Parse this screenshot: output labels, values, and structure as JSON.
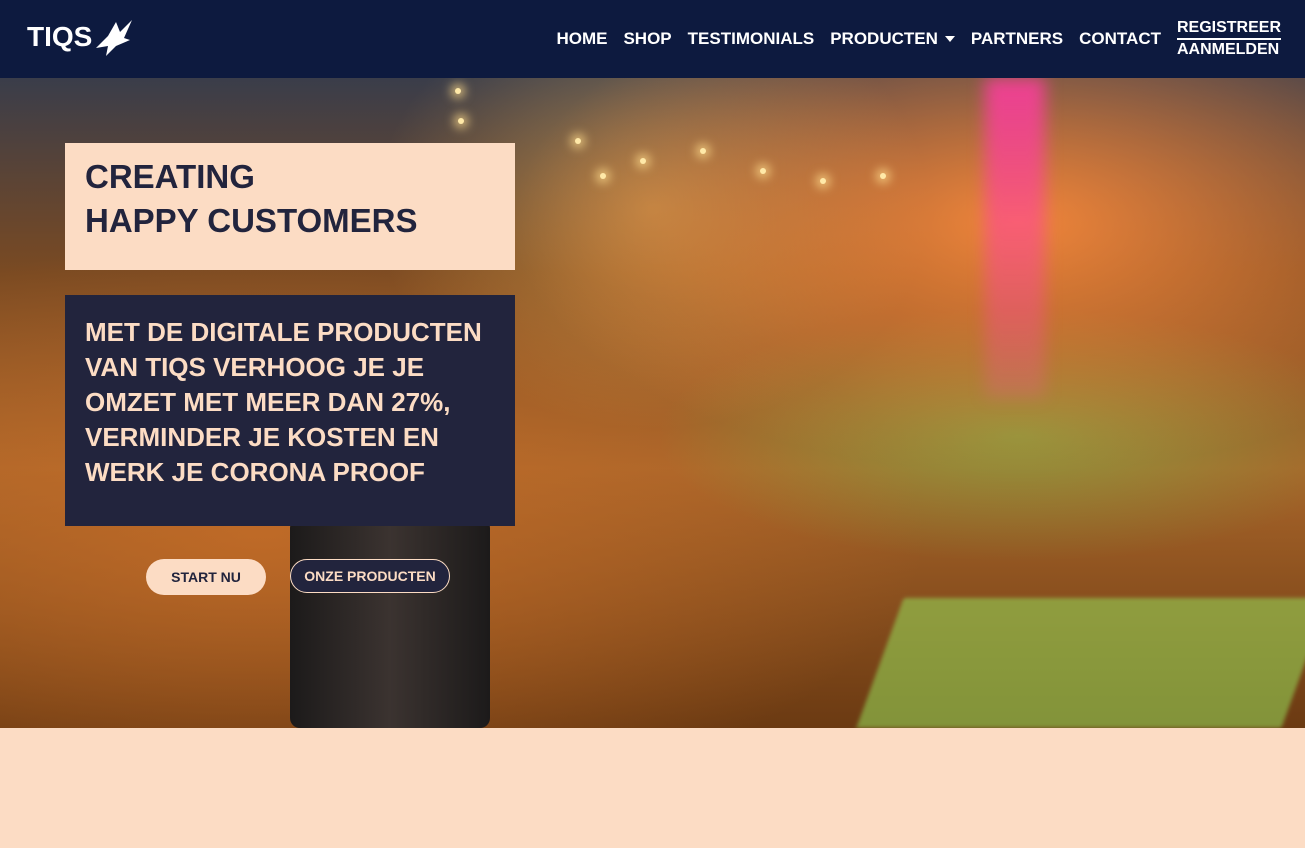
{
  "brand": {
    "name": "TIQS"
  },
  "nav": {
    "items": [
      {
        "label": "HOME"
      },
      {
        "label": "SHOP"
      },
      {
        "label": "TESTIMONIALS"
      },
      {
        "label": "PRODUCTEN"
      },
      {
        "label": "PARTNERS"
      },
      {
        "label": "CONTACT"
      }
    ],
    "register_label": "REGISTREER",
    "login_label": "AANMELDEN"
  },
  "hero": {
    "headline_line1": "CREATING",
    "headline_line2": "HAPPY CUSTOMERS",
    "subtext": "MET DE DIGITALE PRODUCTEN VAN TIQS VERHOOG JE JE OMZET MET MEER DAN 27%, VERMINDER JE KOSTEN EN WERK JE CORONA PROOF",
    "start_button": "START NU",
    "products_button": "ONZE PRODUCTEN"
  },
  "colors": {
    "navbar_bg": "#0d1a3f",
    "peach": "#fcdcc4",
    "navy": "#22243d"
  },
  "icons": {
    "logo_mark": "bird-icon",
    "dropdown": "caret-down-icon"
  }
}
